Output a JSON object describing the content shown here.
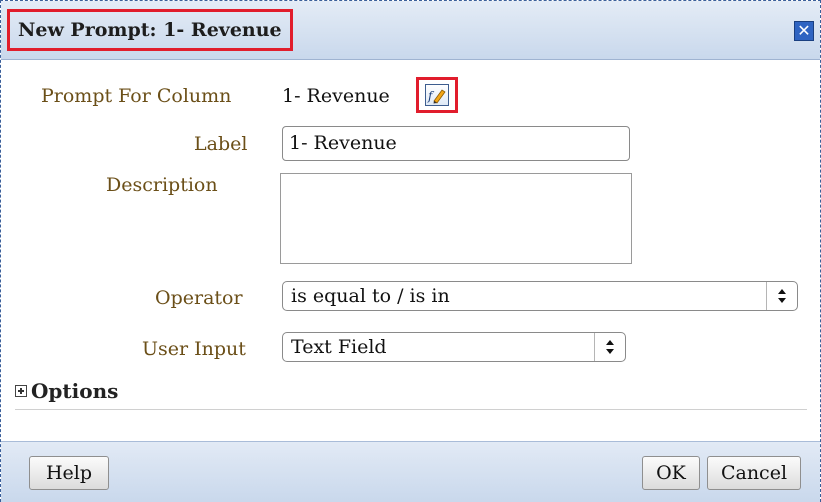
{
  "dialog": {
    "title": "New Prompt: 1- Revenue",
    "close_icon": "close-icon"
  },
  "form": {
    "prompt_for_column_label": "Prompt For Column",
    "prompt_for_column_value": "1- Revenue",
    "edit_formula_icon": "edit-formula-icon",
    "label_label": "Label",
    "label_value": "1- Revenue",
    "description_label": "Description",
    "description_value": "",
    "operator_label": "Operator",
    "operator_value": "is equal to / is in",
    "user_input_label": "User Input",
    "user_input_value": "Text Field",
    "options_label": "Options"
  },
  "footer": {
    "help_label": "Help",
    "ok_label": "OK",
    "cancel_label": "Cancel"
  },
  "colors": {
    "highlight": "#e11d2c",
    "label_text": "#6b4f18",
    "titlebar": "#c9d8ec"
  }
}
